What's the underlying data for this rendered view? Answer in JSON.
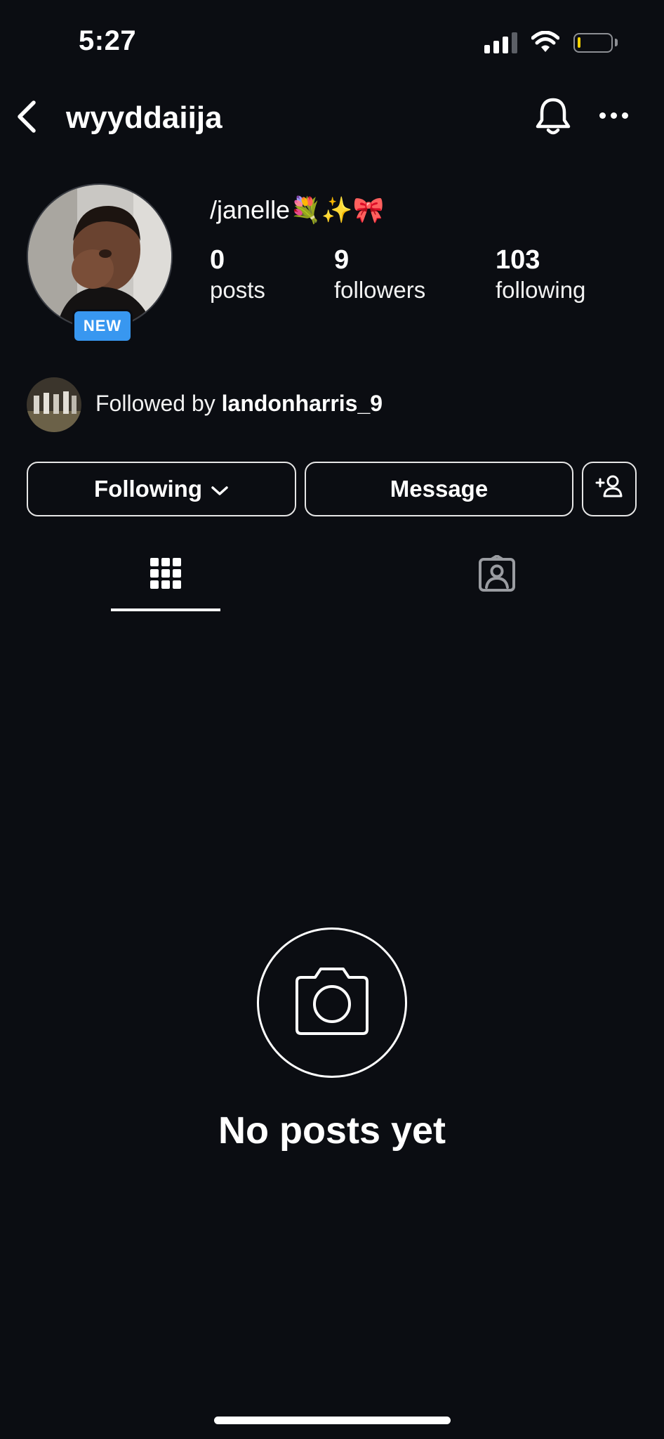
{
  "status_bar": {
    "time": "5:27"
  },
  "header": {
    "username": "wyyddaiija"
  },
  "profile": {
    "full_name": "/janelle💐✨🎀",
    "new_badge": "NEW",
    "stats": [
      {
        "count": "0",
        "label": "posts"
      },
      {
        "count": "9",
        "label": "followers"
      },
      {
        "count": "103",
        "label": "following"
      }
    ],
    "followed_by_prefix": "Followed by ",
    "followed_by_user": "landonharris_9"
  },
  "actions": {
    "following_label": "Following",
    "message_label": "Message"
  },
  "tabs": [
    {
      "icon": "grid-icon",
      "active": true
    },
    {
      "icon": "tagged-icon",
      "active": false
    }
  ],
  "empty_state": {
    "title": "No posts yet"
  },
  "colors": {
    "background": "#0b0d12",
    "badge": "#3897f0",
    "battery_low": "#f7d300"
  }
}
